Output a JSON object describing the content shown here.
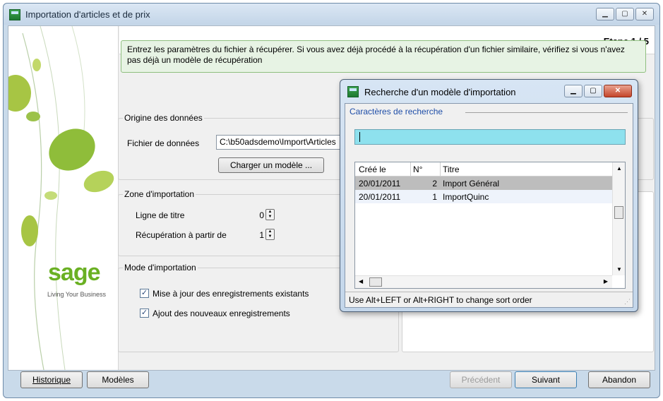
{
  "window": {
    "title": "Importation d'articles et de prix",
    "step": "Etape  1 / 5",
    "info_text": "Entrez les paramètres du fichier à récupérer. Si vous avez déjà procédé à la récupération d'un fichier similaire, vérifiez si vous n'avez pas déjà un modèle de récupération"
  },
  "brand": {
    "logo_text": "sage",
    "tagline": "Living Your Business",
    "accent": "#6ab023"
  },
  "origine": {
    "legend": "Origine des données",
    "file_label": "Fichier de données",
    "file_value": "C:\\b50adsdemo\\Import\\Articles",
    "load_button": "Charger un modèle ..."
  },
  "zone": {
    "legend": "Zone d'importation",
    "title_line_label": "Ligne de titre",
    "title_line_value": "0",
    "start_label": "Récupération à partir de",
    "start_value": "1"
  },
  "mode": {
    "legend": "Mode d'importation",
    "update_label": "Mise à jour des enregistrements existants",
    "add_label": "Ajout des nouveaux enregistrements",
    "update_checked": true,
    "add_checked": true
  },
  "footer": {
    "historique": "Historique",
    "modeles": "Modèles",
    "precedent": "Précédent",
    "suivant": "Suivant",
    "abandon": "Abandon"
  },
  "dialog": {
    "title": "Recherche d'un modèle d'importation",
    "section": "Caractères de recherche",
    "search_value": "",
    "columns": [
      "Créé le",
      "N°",
      "Titre"
    ],
    "rows": [
      {
        "date": "20/01/2011",
        "num": "2",
        "title": "Import Général",
        "selected": true
      },
      {
        "date": "20/01/2011",
        "num": "1",
        "title": "ImportQuinc",
        "selected": false
      }
    ],
    "status": "Use Alt+LEFT or Alt+RIGHT to change sort order"
  }
}
